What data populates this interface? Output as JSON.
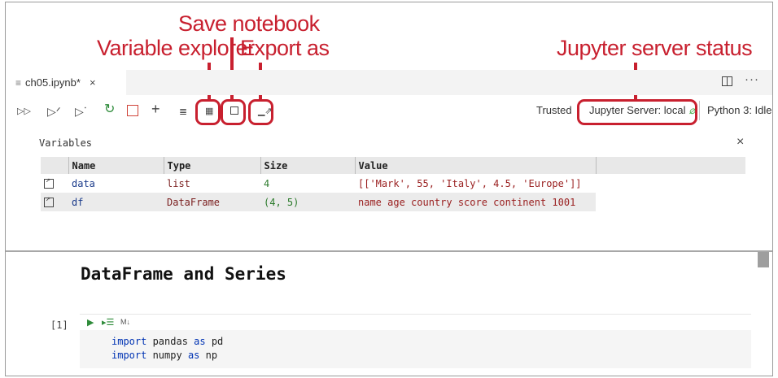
{
  "callouts": {
    "save_notebook": "Save notebook",
    "variable_explorer": "Variable explorer",
    "export_as": "Export as",
    "server_status": "Jupyter server status"
  },
  "tab": {
    "filename": "ch05.ipynb*",
    "close_glyph": "×"
  },
  "toolbar": {
    "icons": [
      "run-all-icon",
      "run-above-icon",
      "run-below-icon",
      "restart-icon",
      "interrupt-icon",
      "add-cell-icon",
      "clear-output-icon",
      "variables-icon",
      "save-icon",
      "export-icon"
    ],
    "trusted": "Trusted",
    "server": "Jupyter Server: local",
    "kernel": "Python 3: Idle"
  },
  "variables": {
    "title": "Variables",
    "columns": [
      "Name",
      "Type",
      "Size",
      "Value"
    ],
    "rows": [
      {
        "name": "data",
        "type": "list",
        "size": "4",
        "value": "[['Mark', 55, 'Italy', 4.5, 'Europe']]"
      },
      {
        "name": "df",
        "type": "DataFrame",
        "size": "(4, 5)",
        "value": "name age country score continent 1001"
      }
    ]
  },
  "notebook": {
    "heading": "DataFrame and Series",
    "exec_count": "[1]",
    "md_label": "M↓",
    "code": {
      "line1": {
        "kw1": "import",
        "mod": " pandas ",
        "kw2": "as",
        "alias": " pd"
      },
      "line2": {
        "kw1": "import",
        "mod": " numpy ",
        "kw2": "as",
        "alias": " np"
      }
    }
  },
  "colors": {
    "callout": "#c8202f",
    "name": "#1a3a8a",
    "type": "#7a1e1e",
    "size": "#2b7a2b",
    "value": "#9a2020"
  }
}
